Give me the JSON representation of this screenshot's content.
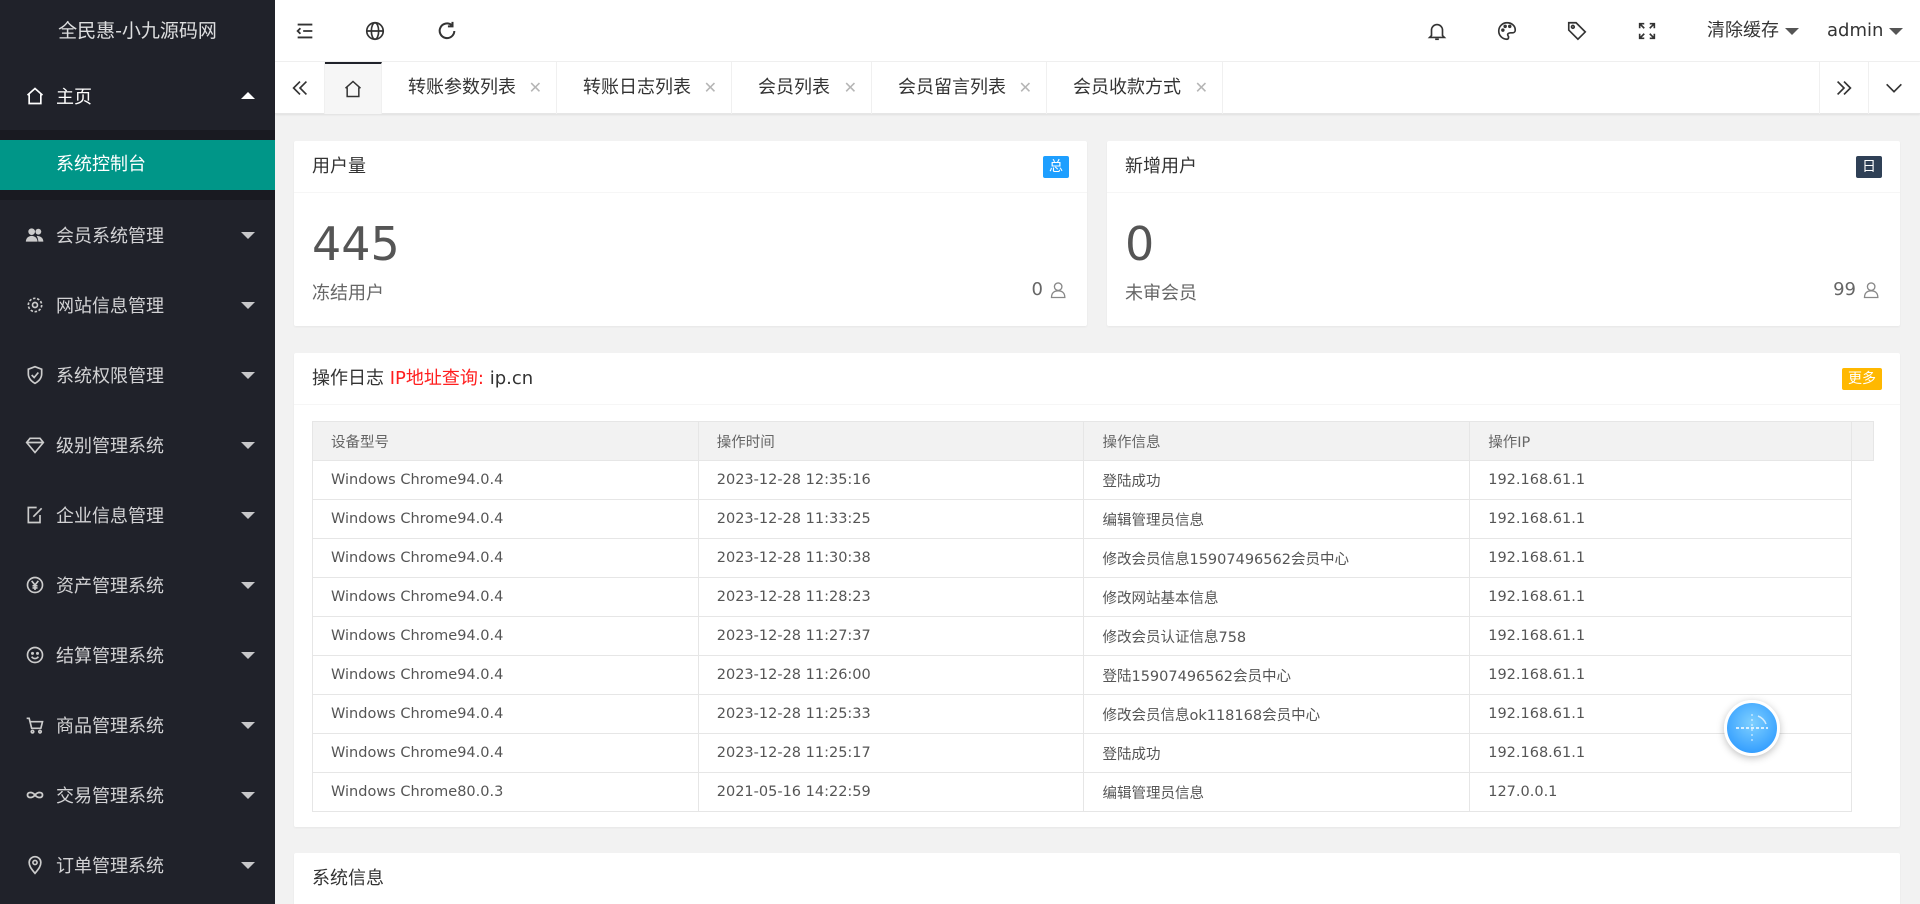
{
  "logo": "全民惠-小九源码网",
  "sidebar": {
    "home": "主页",
    "home_sub": "系统控制台",
    "items": [
      {
        "label": "会员系统管理",
        "icon": "users-icon"
      },
      {
        "label": "网站信息管理",
        "icon": "gear-icon"
      },
      {
        "label": "系统权限管理",
        "icon": "shield-icon"
      },
      {
        "label": "级别管理系统",
        "icon": "diamond-icon"
      },
      {
        "label": "企业信息管理",
        "icon": "edit-icon"
      },
      {
        "label": "资产管理系统",
        "icon": "yen-icon"
      },
      {
        "label": "结算管理系统",
        "icon": "smile-icon"
      },
      {
        "label": "商品管理系统",
        "icon": "cart-icon"
      },
      {
        "label": "交易管理系统",
        "icon": "link-icon"
      },
      {
        "label": "订单管理系统",
        "icon": "location-icon"
      }
    ]
  },
  "header": {
    "clear_cache": "清除缓存",
    "user": "admin"
  },
  "tabs": [
    "转账参数列表",
    "转账日志列表",
    "会员列表",
    "会员留言列表",
    "会员收款方式"
  ],
  "cards": {
    "users": {
      "title": "用户量",
      "badge": "总",
      "value": "445",
      "label": "冻结用户",
      "right_value": "0"
    },
    "new_users": {
      "title": "新增用户",
      "badge": "日",
      "value": "0",
      "label": "未审会员",
      "right_value": "99"
    }
  },
  "log": {
    "title": "操作日志",
    "ip_label": "IP地址查询:",
    "ip_site": "ip.cn",
    "more": "更多",
    "columns": [
      "设备型号",
      "操作时间",
      "操作信息",
      "操作IP"
    ],
    "rows": [
      [
        "Windows Chrome94.0.4",
        "2023-12-28 12:35:16",
        "登陆成功",
        "192.168.61.1"
      ],
      [
        "Windows Chrome94.0.4",
        "2023-12-28 11:33:25",
        "编辑管理员信息",
        "192.168.61.1"
      ],
      [
        "Windows Chrome94.0.4",
        "2023-12-28 11:30:38",
        "修改会员信息15907496562会员中心",
        "192.168.61.1"
      ],
      [
        "Windows Chrome94.0.4",
        "2023-12-28 11:28:23",
        "修改网站基本信息",
        "192.168.61.1"
      ],
      [
        "Windows Chrome94.0.4",
        "2023-12-28 11:27:37",
        "修改会员认证信息758",
        "192.168.61.1"
      ],
      [
        "Windows Chrome94.0.4",
        "2023-12-28 11:26:00",
        "登陆15907496562会员中心",
        "192.168.61.1"
      ],
      [
        "Windows Chrome94.0.4",
        "2023-12-28 11:25:33",
        "修改会员信息ok118168会员中心",
        "192.168.61.1"
      ],
      [
        "Windows Chrome94.0.4",
        "2023-12-28 11:25:17",
        "登陆成功",
        "192.168.61.1"
      ],
      [
        "Windows Chrome80.0.3",
        "2021-05-16 14:22:59",
        "编辑管理员信息",
        "127.0.0.1"
      ]
    ]
  },
  "sysinfo": {
    "title": "系统信息"
  },
  "colors": {
    "sidebar_bg": "#20222a",
    "active": "#009688",
    "badge_blue": "#1e9fff",
    "badge_dark": "#2f4056",
    "badge_orange": "#ffb800",
    "red": "#ff1e1e"
  }
}
